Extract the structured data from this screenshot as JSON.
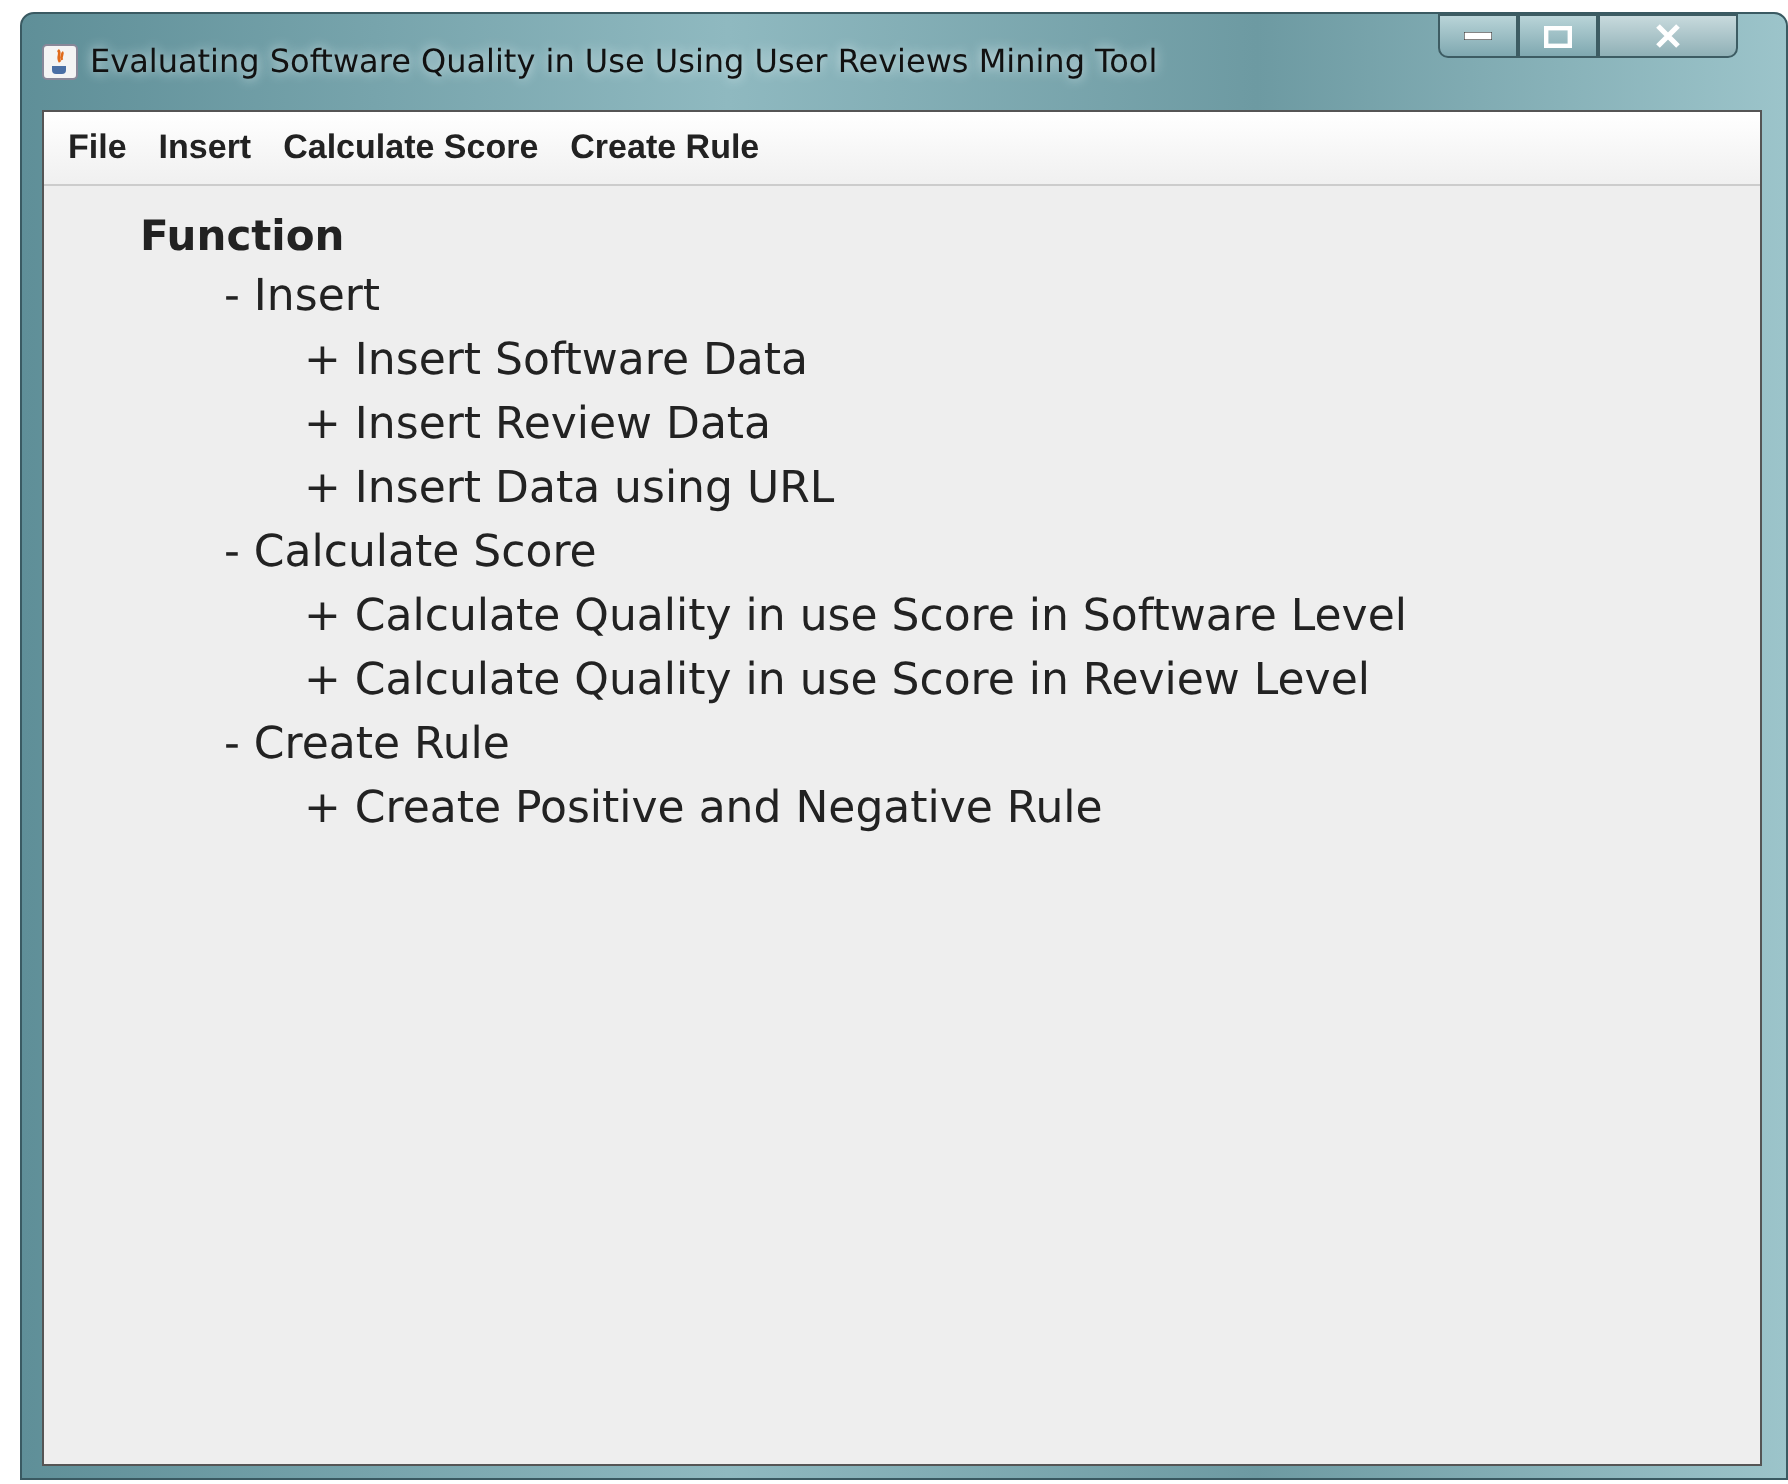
{
  "window": {
    "title": "Evaluating Software Quality in Use Using User Reviews Mining Tool"
  },
  "menu": [
    "File",
    "Insert",
    "Calculate Score",
    "Create Rule"
  ],
  "content": {
    "heading": "Function",
    "items": [
      {
        "label": "- Insert",
        "children": [
          {
            "label": "+ Insert Software Data"
          },
          {
            "label": "+ Insert Review Data"
          },
          {
            "label": "+ Insert Data using URL"
          }
        ]
      },
      {
        "label": "- Calculate Score",
        "children": [
          {
            "label": "+ Calculate Quality in use Score in Software Level"
          },
          {
            "label": "+ Calculate Quality in use Score in Review Level"
          }
        ]
      },
      {
        "label": "- Create Rule",
        "children": [
          {
            "label": "+ Create Positive and Negative Rule"
          }
        ]
      }
    ]
  }
}
